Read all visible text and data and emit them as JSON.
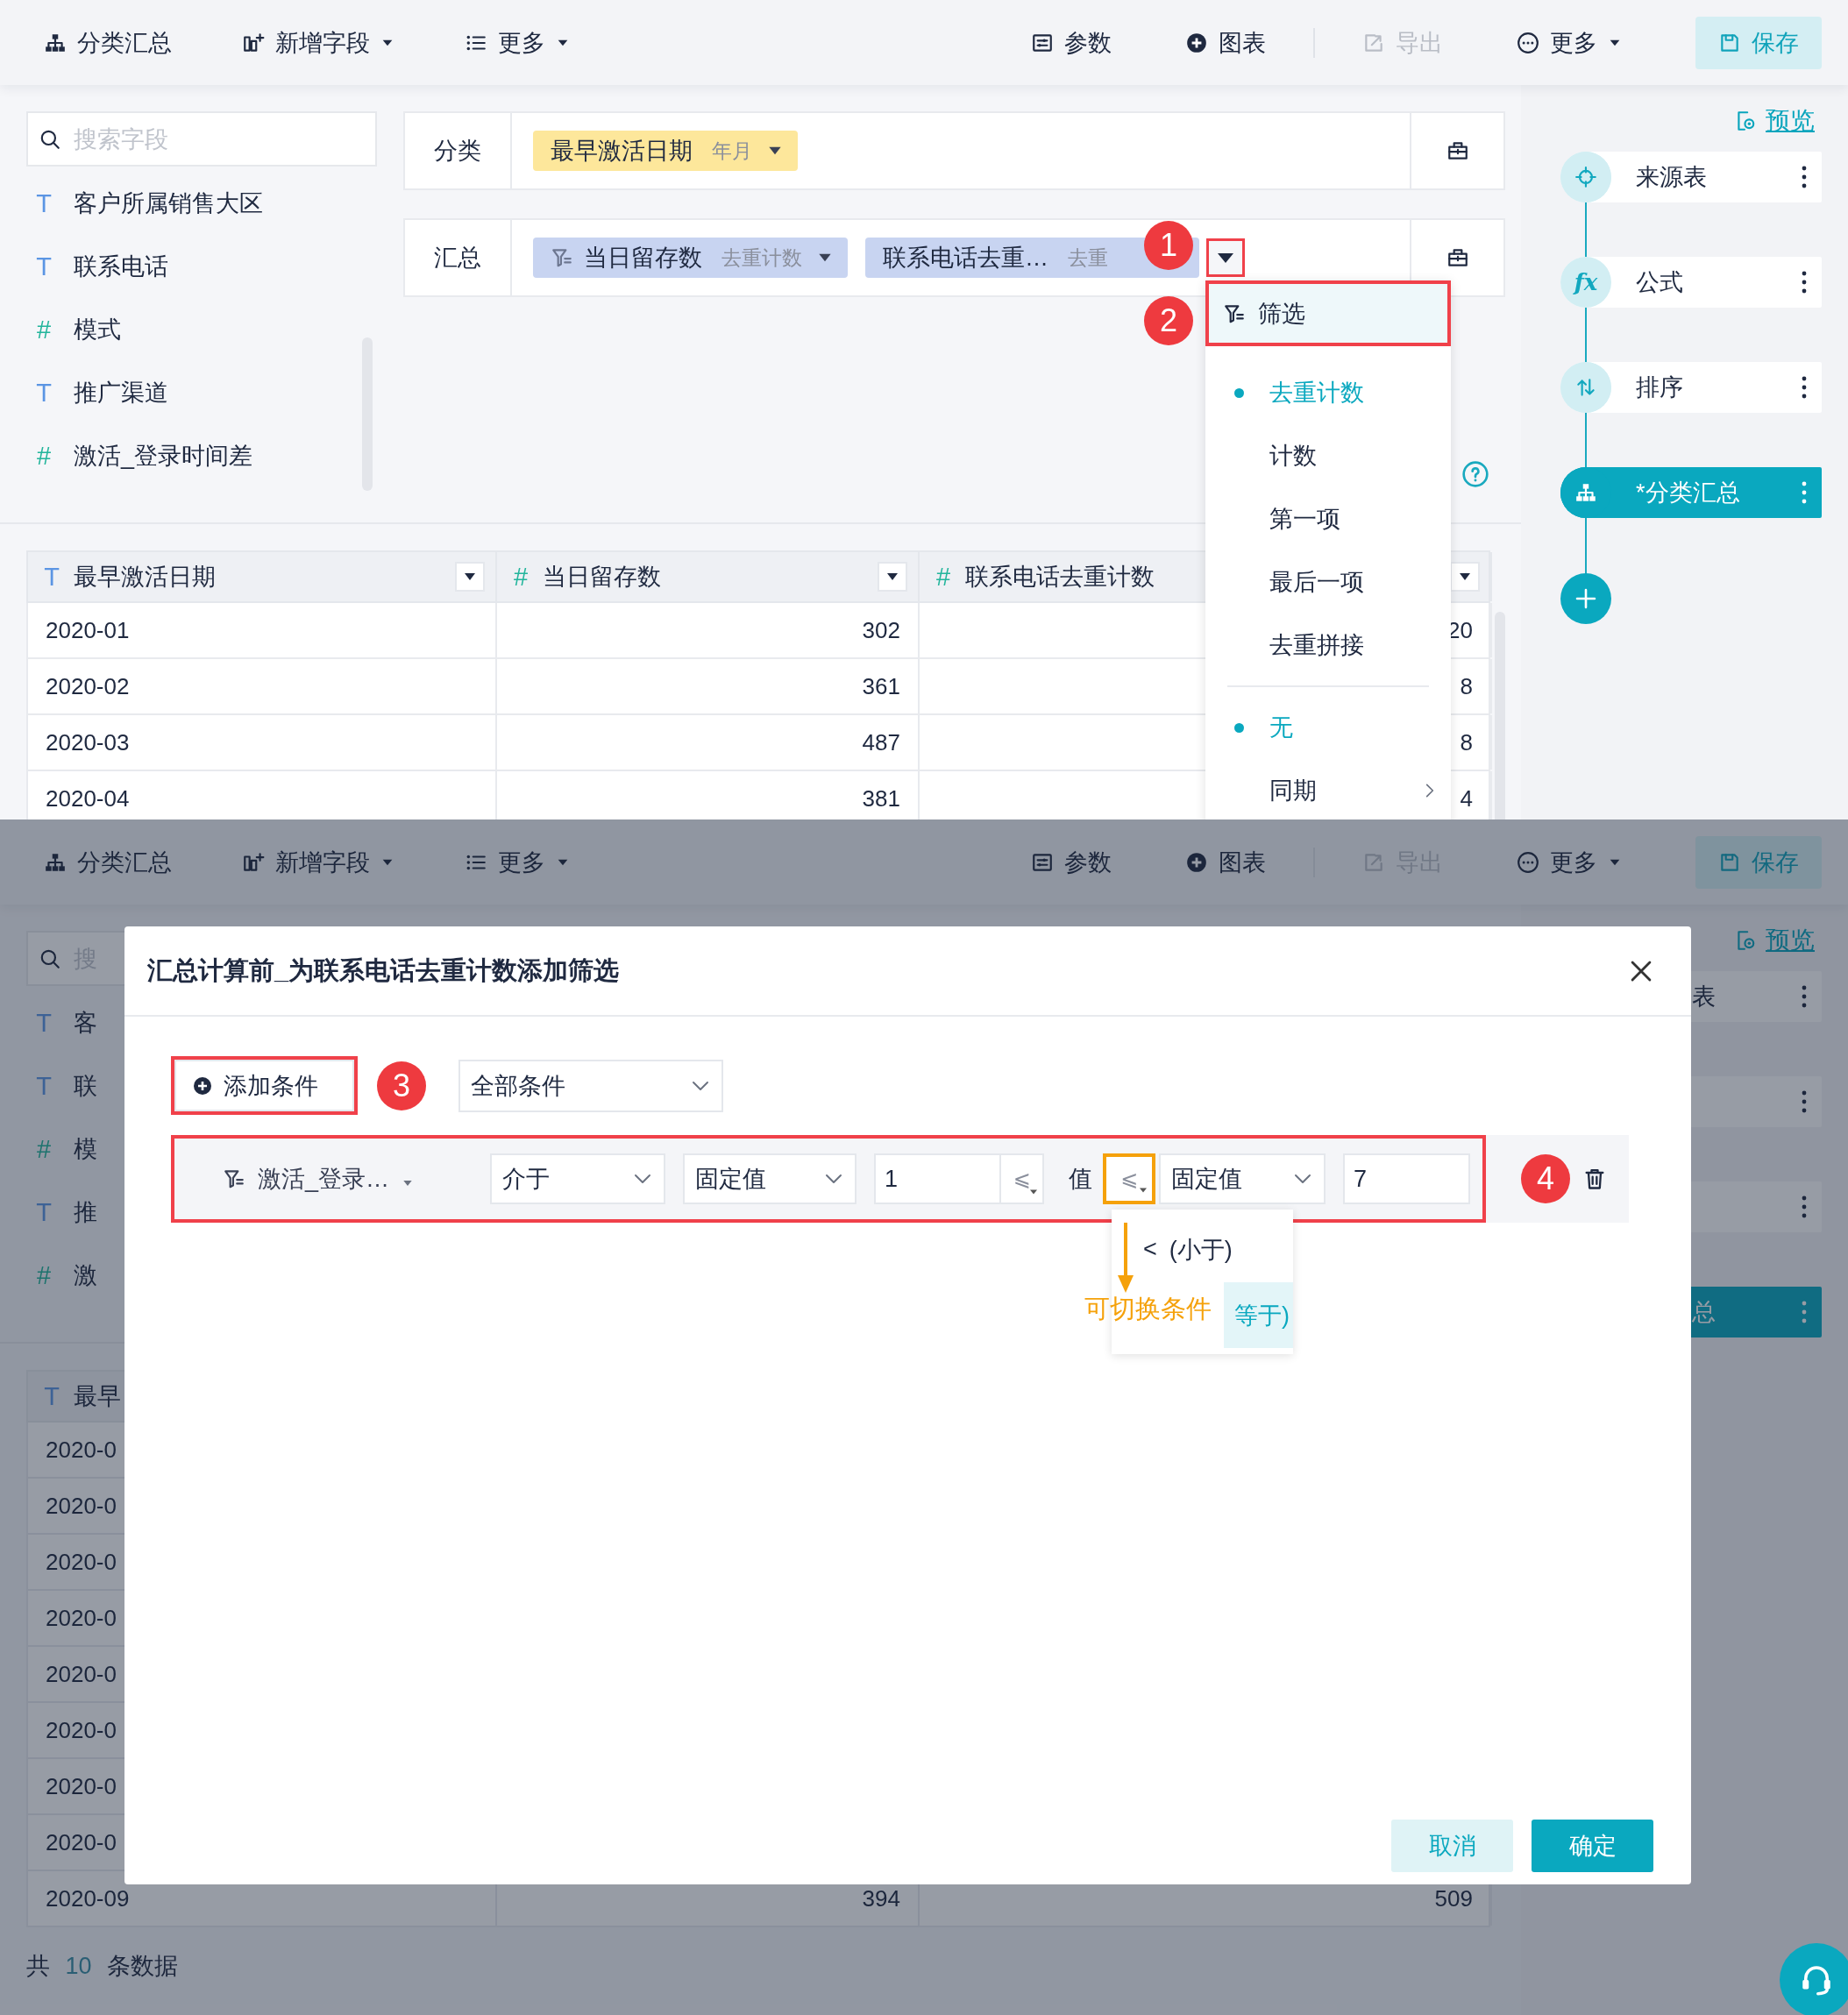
{
  "screens": [
    {
      "toolbar": {
        "left": [
          {
            "label": "分类汇总",
            "caret": false
          },
          {
            "label": "新增字段",
            "caret": true
          },
          {
            "label": "更多",
            "caret": true
          }
        ],
        "right": [
          {
            "label": "参数",
            "caret": false,
            "disabled": false
          },
          {
            "label": "图表",
            "caret": false,
            "disabled": false
          },
          {
            "label": "导出",
            "caret": false,
            "disabled": true
          },
          {
            "label": "更多",
            "caret": true,
            "disabled": false
          }
        ],
        "save": "保存"
      },
      "search": {
        "placeholder": "搜索字段"
      },
      "fields": [
        {
          "kind": "text",
          "glyph": "T",
          "name": "客户所属销售大区"
        },
        {
          "kind": "text",
          "glyph": "T",
          "name": "联系电话"
        },
        {
          "kind": "number",
          "glyph": "#",
          "name": "模式"
        },
        {
          "kind": "text",
          "glyph": "T",
          "name": "推广渠道"
        },
        {
          "kind": "number",
          "glyph": "#",
          "name": "激活_登录时间差"
        }
      ],
      "config": [
        {
          "label": "分类",
          "chips": [
            {
              "kind": "dimension",
              "name": "最早激活日期",
              "agg": "年月",
              "filter": false,
              "highlighted": false
            }
          ]
        },
        {
          "label": "汇总",
          "chips": [
            {
              "kind": "measure",
              "name": "当日留存数",
              "agg": "去重计数",
              "filter": true,
              "highlighted": false
            },
            {
              "kind": "measure",
              "name": "联系电话去重…",
              "agg": "去重",
              "filter": false,
              "highlighted": true
            }
          ]
        }
      ],
      "table": {
        "columns": [
          {
            "kind": "text",
            "glyph": "T",
            "name": "最早激活日期",
            "dropdown": true
          },
          {
            "kind": "number",
            "glyph": "#",
            "name": "当日留存数",
            "dropdown": true
          },
          {
            "kind": "number",
            "glyph": "#",
            "name": "联系电话去重计数",
            "dropdown": true
          }
        ],
        "rows": [
          [
            "2020-01",
            "302",
            "20"
          ],
          [
            "2020-02",
            "361",
            "8"
          ],
          [
            "2020-03",
            "487",
            "8"
          ],
          [
            "2020-04",
            "381",
            "4"
          ]
        ]
      },
      "menu": {
        "filter": "筛选",
        "aggregations": [
          {
            "label": "去重计数",
            "selected": true
          },
          {
            "label": "计数",
            "selected": false
          },
          {
            "label": "第一项",
            "selected": false
          },
          {
            "label": "最后一项",
            "selected": false
          },
          {
            "label": "去重拼接",
            "selected": false
          }
        ],
        "comparisons": [
          {
            "label": "无",
            "selected": true,
            "submenu": false
          },
          {
            "label": "同期",
            "selected": false,
            "submenu": true
          }
        ]
      },
      "callouts": [
        "1",
        "2"
      ],
      "flow": {
        "preview": "预览",
        "nodes": [
          {
            "kind": "source",
            "label": "来源表",
            "selected": false
          },
          {
            "kind": "formula",
            "glyph": "fx",
            "label": "公式",
            "selected": false
          },
          {
            "kind": "sort",
            "label": "排序",
            "selected": false
          },
          {
            "kind": "group",
            "label": "*分类汇总",
            "selected": true
          }
        ],
        "add": true
      }
    },
    {
      "toolbar": {
        "left": [
          {
            "label": "分类汇总",
            "caret": false
          },
          {
            "label": "新增字段",
            "caret": true
          },
          {
            "label": "更多",
            "caret": true
          }
        ],
        "right": [
          {
            "label": "参数",
            "caret": false,
            "disabled": false
          },
          {
            "label": "图表",
            "caret": false,
            "disabled": false
          },
          {
            "label": "导出",
            "caret": false,
            "disabled": true
          },
          {
            "label": "更多",
            "caret": true,
            "disabled": false
          }
        ],
        "save": "保存"
      },
      "search": {
        "placeholder": "搜"
      },
      "fields": [
        {
          "kind": "text",
          "glyph": "T",
          "name": "客"
        },
        {
          "kind": "text",
          "glyph": "T",
          "name": "联"
        },
        {
          "kind": "number",
          "glyph": "#",
          "name": "模"
        },
        {
          "kind": "text",
          "glyph": "T",
          "name": "推"
        },
        {
          "kind": "number",
          "glyph": "#",
          "name": "激"
        }
      ],
      "table": {
        "columns": [
          {
            "kind": "text",
            "glyph": "T",
            "name": "最早"
          }
        ],
        "rows": [
          [
            "2020-0"
          ],
          [
            "2020-0"
          ],
          [
            "2020-0"
          ],
          [
            "2020-0"
          ],
          [
            "2020-0"
          ],
          [
            "2020-0"
          ],
          [
            "2020-0"
          ],
          [
            "2020-0"
          ],
          [
            "2020-09",
            "394",
            "509"
          ]
        ]
      },
      "total": {
        "prefix": "共",
        "count": "10",
        "suffix": "条数据"
      },
      "flow": {
        "preview": "预览",
        "nodes": [
          {
            "label": "表",
            "selected": false
          },
          {
            "selected": false
          },
          {
            "selected": false
          },
          {
            "label": "总",
            "selected": true
          }
        ]
      },
      "dialog": {
        "title": "汇总计算前_为联系电话去重计数添加筛选",
        "add_condition": "添加条件",
        "match": "全部条件",
        "condition": {
          "field": "激活_登录…",
          "operator": "介于",
          "lower": {
            "mode": "固定值",
            "value": "1",
            "op": "⩽"
          },
          "value_label": "值",
          "upper": {
            "op": "⩽",
            "mode": "固定值",
            "value": "7"
          }
        },
        "op_options": [
          {
            "symbol": "<",
            "text": "(小于)",
            "selected": false
          },
          {
            "text": "等于)",
            "selected": true
          }
        ],
        "annotation": "可切换条件",
        "callouts": [
          "3",
          "4"
        ],
        "cancel": "取消",
        "confirm": "确定"
      },
      "chat": true
    }
  ]
}
